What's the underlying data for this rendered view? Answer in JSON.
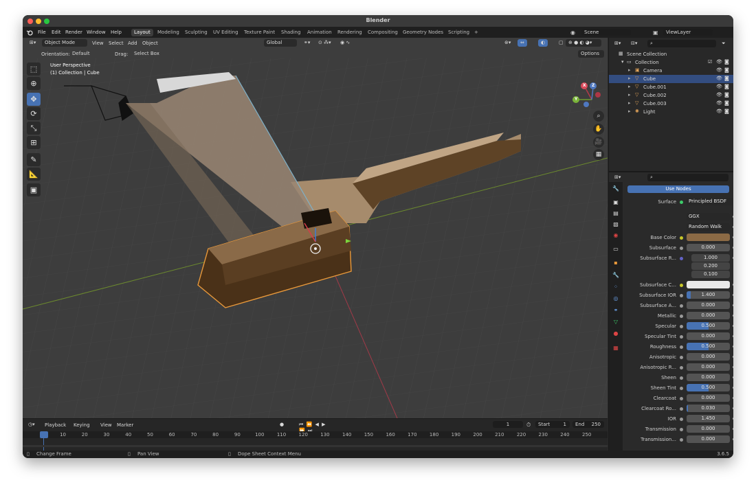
{
  "window": {
    "title": "Blender"
  },
  "menu": [
    "File",
    "Edit",
    "Render",
    "Window",
    "Help"
  ],
  "workspaces": [
    "Layout",
    "Modeling",
    "Sculpting",
    "UV Editing",
    "Texture Paint",
    "Shading",
    "Animation",
    "Rendering",
    "Compositing",
    "Geometry Nodes",
    "Scripting"
  ],
  "active_workspace": "Layout",
  "add_workspace": "+",
  "scene": {
    "name": "Scene",
    "view_layer": "ViewLayer"
  },
  "viewport": {
    "mode": "Object Mode",
    "menus": [
      "View",
      "Select",
      "Add",
      "Object"
    ],
    "transform_orientation": "Global",
    "orientation_label": "Orientation:",
    "orientation_value": "Default",
    "drag_label": "Drag:",
    "drag_value": "Select Box",
    "options": "Options",
    "overlay_title": "User Perspective",
    "overlay_sub": "(1) Collection | Cube",
    "gizmo_x": "X",
    "gizmo_y": "Y",
    "gizmo_z": "Z"
  },
  "timeline": {
    "menus": [
      "Playback",
      "Keying",
      "View",
      "Marker"
    ],
    "current_frame": "1",
    "start_label": "Start",
    "start": "1",
    "end_label": "End",
    "end": "250",
    "ticks": [
      "1",
      "10",
      "20",
      "30",
      "40",
      "50",
      "60",
      "70",
      "80",
      "90",
      "100",
      "110",
      "120",
      "130",
      "140",
      "150",
      "160",
      "170",
      "180",
      "190",
      "200",
      "210",
      "220",
      "230",
      "240",
      "250"
    ]
  },
  "status": {
    "left": "Change Frame",
    "mid": "Pan View",
    "right": "Dope Sheet Context Menu",
    "version": "3.6.5"
  },
  "outliner": {
    "root": "Scene Collection",
    "collection": "Collection",
    "items": [
      {
        "name": "Camera",
        "selected": false,
        "icon_color": "#e2a45a"
      },
      {
        "name": "Cube",
        "selected": true,
        "icon_color": "#e2a45a"
      },
      {
        "name": "Cube.001",
        "selected": false,
        "icon_color": "#e2a45a"
      },
      {
        "name": "Cube.002",
        "selected": false,
        "icon_color": "#e2a45a"
      },
      {
        "name": "Cube.003",
        "selected": false,
        "icon_color": "#e2a45a"
      },
      {
        "name": "Light",
        "selected": false,
        "icon_color": "#e2a45a"
      }
    ]
  },
  "properties": {
    "use_nodes": "Use Nodes",
    "surface_label": "Surface",
    "surface_value": "Principled BSDF",
    "distribution": "GGX",
    "subsurface_method": "Random Walk",
    "base_color_label": "Base Color",
    "base_color": "#8b6a45",
    "subsurface_radius_label": "Subsurface R...",
    "subsurface_radius": [
      "1.000",
      "0.200",
      "0.100"
    ],
    "subsurface_color_label": "Subsurface C...",
    "subsurface_color": "#e8e8e8",
    "rows_before": [
      {
        "label": "Subsurface",
        "value": "0.000",
        "fill": 0
      }
    ],
    "rows": [
      {
        "label": "Subsurface IOR",
        "value": "1.400",
        "fill": 0.1
      },
      {
        "label": "Subsurface A...",
        "value": "0.000",
        "fill": 0
      },
      {
        "label": "Metallic",
        "value": "0.000",
        "fill": 0
      },
      {
        "label": "Specular",
        "value": "0.500",
        "fill": 0.5
      },
      {
        "label": "Specular Tint",
        "value": "0.000",
        "fill": 0
      },
      {
        "label": "Roughness",
        "value": "0.500",
        "fill": 0.5
      },
      {
        "label": "Anisotropic",
        "value": "0.000",
        "fill": 0
      },
      {
        "label": "Anisotropic R...",
        "value": "0.000",
        "fill": 0
      },
      {
        "label": "Sheen",
        "value": "0.000",
        "fill": 0
      },
      {
        "label": "Sheen Tint",
        "value": "0.500",
        "fill": 0.5
      },
      {
        "label": "Clearcoat",
        "value": "0.000",
        "fill": 0
      },
      {
        "label": "Clearcoat Ro...",
        "value": "0.030",
        "fill": 0.03
      },
      {
        "label": "IOR",
        "value": "1.450",
        "fill": 0
      },
      {
        "label": "Transmission",
        "value": "0.000",
        "fill": 0
      },
      {
        "label": "Transmission...",
        "value": "0.000",
        "fill": 0
      }
    ]
  },
  "colors": {
    "accent": "#4772b3",
    "selection": "#e8983a",
    "axis_x": "#c03a4a",
    "axis_y": "#7aa83a"
  }
}
